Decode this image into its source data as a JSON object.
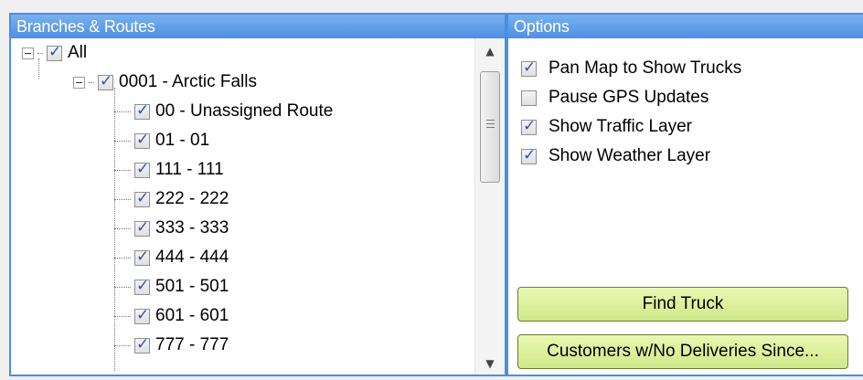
{
  "left_panel": {
    "header": "Branches & Routes",
    "tree": {
      "root": {
        "label": "All",
        "checked": true
      },
      "branch": {
        "label": "0001 - Arctic Falls",
        "checked": true
      },
      "routes": [
        {
          "label": "00 - Unassigned Route",
          "checked": true
        },
        {
          "label": "01 - 01",
          "checked": true
        },
        {
          "label": "111 - 111",
          "checked": true
        },
        {
          "label": "222 - 222",
          "checked": true
        },
        {
          "label": "333 - 333",
          "checked": true
        },
        {
          "label": "444 - 444",
          "checked": true
        },
        {
          "label": "501 - 501",
          "checked": true
        },
        {
          "label": "601 - 601",
          "checked": true
        },
        {
          "label": "777 - 777",
          "checked": true
        }
      ]
    },
    "scroll_up_icon": "arrow-up",
    "scroll_down_icon": "arrow-down"
  },
  "right_panel": {
    "header": "Options",
    "options": [
      {
        "label": "Pan Map to Show Trucks",
        "checked": true
      },
      {
        "label": "Pause GPS Updates",
        "checked": false
      },
      {
        "label": "Show Traffic Layer",
        "checked": true
      },
      {
        "label": "Show Weather Layer",
        "checked": true
      }
    ],
    "find_truck_button": "Find Truck",
    "customers_button": "Customers w/No Deliveries Since..."
  },
  "colors": {
    "header_blue": "#4f8fe4",
    "button_green": "#cfe88a",
    "check_blue": "#2a55b8"
  }
}
